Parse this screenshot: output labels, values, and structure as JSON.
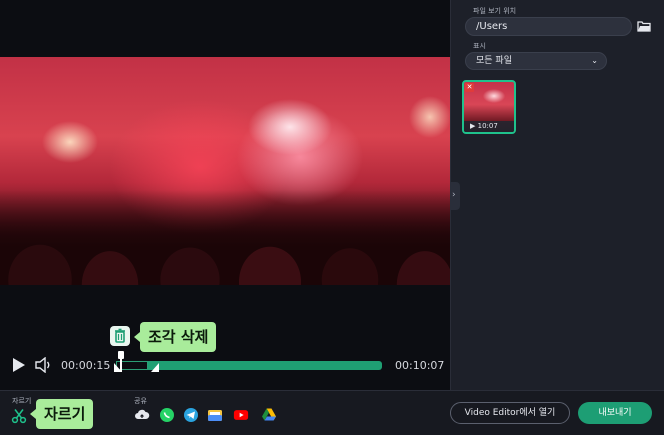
{
  "player": {
    "current_time": "00:00:15",
    "total_time": "00:10:07"
  },
  "callouts": {
    "delete_segment": "조각 삭제",
    "cut": "자르기"
  },
  "panel": {
    "location_label": "파일 보기 위치",
    "location_value": "/Users",
    "show_label": "표시",
    "show_value": "모든 파일",
    "thumbnail_duration": "10:07"
  },
  "bottom": {
    "cut_label": "자르기",
    "share_label": "공유",
    "share_icons": [
      "cloud-icon",
      "whatsapp-icon",
      "telegram-icon",
      "folder-icon",
      "youtube-icon",
      "google-drive-icon"
    ],
    "open_editor_label": "Video Editor에서 열기",
    "export_label": "내보내기"
  },
  "colors": {
    "accent": "#1d9e74",
    "callout": "#a9ec9b",
    "thumbnail_border": "#1fc28c"
  }
}
